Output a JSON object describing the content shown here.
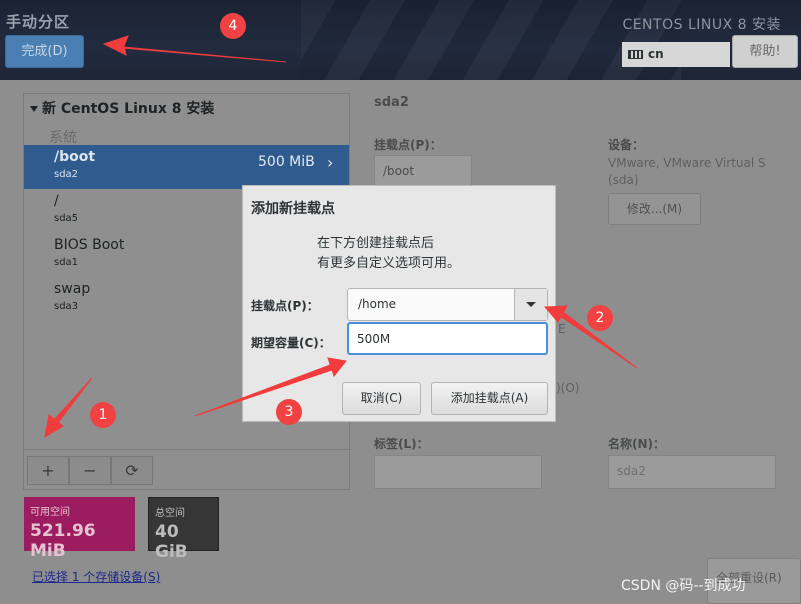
{
  "header": {
    "title": "手动分区",
    "done_label": "完成(D)",
    "product": "CENTOS LINUX 8 安装",
    "keyboard_layout": "cn",
    "help_label": "帮助!"
  },
  "left": {
    "install_title": "新 CentOS Linux 8 安装",
    "group_system": "系统",
    "partitions": [
      {
        "name": "/boot",
        "device": "sda2",
        "size": "500 MiB",
        "selected": true
      },
      {
        "name": "/",
        "device": "sda5"
      },
      {
        "name": "BIOS Boot",
        "device": "sda1"
      },
      {
        "name": "swap",
        "device": "sda3"
      }
    ],
    "tools": {
      "add": "+",
      "remove": "−",
      "refresh": "⟳"
    },
    "available_label": "可用空间",
    "available_value": "521.96 MiB",
    "total_label": "总空间",
    "total_value": "40 GiB",
    "storage_link": "已选择 1 个存储设备(S)"
  },
  "details": {
    "title": "sda2",
    "mount_label": "挂载点(P)：",
    "mount_value": "/boot",
    "device_label": "设备：",
    "device_value_1": "VMware, VMware Virtual S",
    "device_value_2": "(sda)",
    "modify_label": "修改...(M)",
    "partial_e": "E",
    "partial_o": ")(O)",
    "label_label": "标签(L)：",
    "name_label": "名称(N)：",
    "name_value": "sda2",
    "reset_label": "全部重设(R)"
  },
  "dialog": {
    "title": "添加新挂载点",
    "desc_line1": "在下方创建挂载点后",
    "desc_line2": "有更多自定义选项可用。",
    "mount_label": "挂载点(P)：",
    "mount_value": "/home",
    "capacity_label": "期望容量(C)：",
    "capacity_value": "500M",
    "cancel_label": "取消(C)",
    "add_label": "添加挂载点(A)"
  },
  "annotations": {
    "b1": "1",
    "b2": "2",
    "b3": "3",
    "b4": "4",
    "arrow_color": "#f03c3c"
  },
  "watermark": "CSDN @码--到成功"
}
